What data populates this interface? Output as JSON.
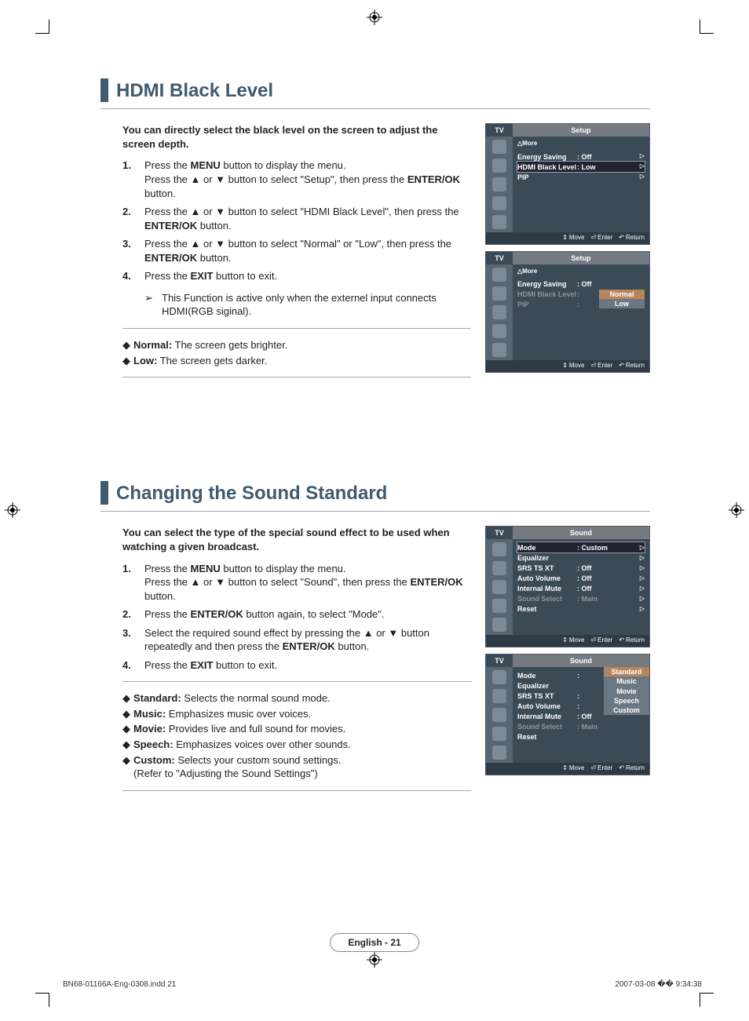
{
  "heading1": "HDMI Black Level",
  "intro1": "You can directly select the black level on the screen to adjust the screen depth.",
  "steps1": [
    {
      "num": "1.",
      "text": "Press the <b>MENU</b> button to display the menu.<br>Press the ▲ or ▼ button to select \"Setup\", then press the <b>ENTER/OK</b> button."
    },
    {
      "num": "2.",
      "text": "Press the ▲ or ▼ button to select \"HDMI Black Level\", then press the <b>ENTER/OK</b> button."
    },
    {
      "num": "3.",
      "text": "Press the ▲ or ▼ button to select \"Normal\" or \"Low\", then press the <b>ENTER/OK</b> button."
    },
    {
      "num": "4.",
      "text": "Press the <b>EXIT</b> button to exit."
    }
  ],
  "noteGlyph": "➢",
  "note1": "This Function is active only when the externel input connects HDMI(RGB siginal).",
  "bullets1": [
    {
      "bold": "Normal:",
      "text": " The screen gets brighter."
    },
    {
      "bold": "Low:",
      "text": " The screen gets darker."
    }
  ],
  "heading2": "Changing the Sound Standard",
  "intro2": "You can select the type of the special sound effect to be used when watching a given broadcast.",
  "steps2": [
    {
      "num": "1.",
      "text": "Press the <b>MENU</b> button to display the menu.<br>Press the ▲ or ▼ button to select \"Sound\", then press the <b>ENTER/OK</b> button."
    },
    {
      "num": "2.",
      "text": "Press the <b>ENTER/OK</b> button again, to select \"Mode\"."
    },
    {
      "num": "3.",
      "text": "Select the required sound effect by pressing the ▲ or ▼ button repeatedly and then press the <b>ENTER/OK</b> button."
    },
    {
      "num": "4.",
      "text": "Press the <b>EXIT</b> button to exit."
    }
  ],
  "bullets2": [
    {
      "bold": "Standard:",
      "text": " Selects the normal sound mode."
    },
    {
      "bold": "Music:",
      "text": " Emphasizes music over voices."
    },
    {
      "bold": "Movie:",
      "text": " Provides live and full sound for movies."
    },
    {
      "bold": "Speech:",
      "text": " Emphasizes voices over other sounds."
    },
    {
      "bold": "Custom:",
      "text": " Selects your custom sound settings.<br>(Refer to \"Adjusting the Sound Settings\")"
    }
  ],
  "osd": {
    "tv": "TV",
    "setupTitle": "Setup",
    "soundTitle": "Sound",
    "more": "△More",
    "rows_setup": [
      {
        "label": "Energy Saving",
        "val": ": Off"
      },
      {
        "label": "HDMI Black Level",
        "val": ": Low",
        "hi": true
      },
      {
        "label": "PIP",
        "val": ""
      }
    ],
    "rows_setup2": [
      {
        "label": "Energy Saving",
        "val": ": Off"
      },
      {
        "label": "HDMI Black Level",
        "val": ":"
      },
      {
        "label": "PIP",
        "val": ":"
      }
    ],
    "setup2_options": [
      {
        "label": "Normal",
        "hi": true
      },
      {
        "label": "Low"
      }
    ],
    "rows_sound": [
      {
        "label": "Mode",
        "val": ": Custom",
        "hi": true
      },
      {
        "label": "Equalizer",
        "val": ""
      },
      {
        "label": "SRS TS XT",
        "val": ": Off"
      },
      {
        "label": "Auto Volume",
        "val": ": Off"
      },
      {
        "label": "Internal Mute",
        "val": ": Off"
      },
      {
        "label": "Sound Select",
        "val": ": Main",
        "dim": true
      },
      {
        "label": "Reset",
        "val": ""
      }
    ],
    "rows_sound2": [
      {
        "label": "Mode",
        "val": ":"
      },
      {
        "label": "Equalizer",
        "val": ""
      },
      {
        "label": "SRS TS XT",
        "val": ":"
      },
      {
        "label": "Auto Volume",
        "val": ":"
      },
      {
        "label": "Internal Mute",
        "val": ": Off"
      },
      {
        "label": "Sound Select",
        "val": ": Main",
        "dim": true
      },
      {
        "label": "Reset",
        "val": ""
      }
    ],
    "sound2_options": [
      {
        "label": "Standard",
        "hi": true
      },
      {
        "label": "Music"
      },
      {
        "label": "Movie"
      },
      {
        "label": "Speech"
      },
      {
        "label": "Custom"
      }
    ],
    "footer": {
      "move": "Move",
      "enter": "Enter",
      "ret": "Return"
    }
  },
  "pageNum": "English - 21",
  "footMeta": {
    "left": "BN68-01166A-Eng-0308.indd   21",
    "right": "2007-03-08   �� 9:34:38"
  }
}
